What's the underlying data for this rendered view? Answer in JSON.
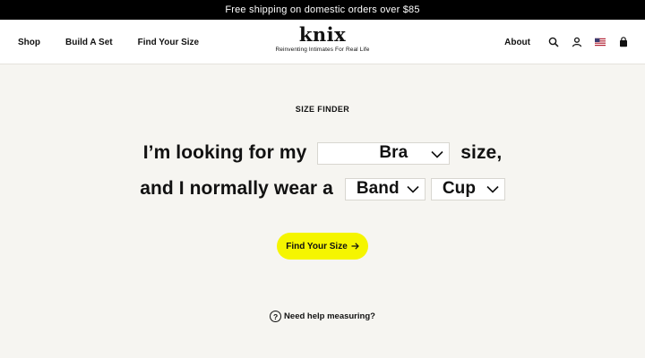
{
  "promo": {
    "text": "Free shipping on domestic orders over $85"
  },
  "nav": {
    "shop": "Shop",
    "build": "Build A Set",
    "find": "Find Your Size",
    "about": "About"
  },
  "logo": {
    "word": "knix",
    "tagline": "Reinventing Intimates For Real Life"
  },
  "icons": {
    "search": "search-icon",
    "account": "account-icon",
    "flag": "us-flag-icon",
    "cart": "shopping-bag-icon"
  },
  "finder": {
    "eyebrow": "SIZE FINDER",
    "line1_prefix": "I’m looking for my ",
    "line1_suffix": " size,",
    "type_value": "Bra",
    "line2_prefix": "and I normally wear a ",
    "band_value": "Band",
    "cup_value": "Cup",
    "cta_label": "Find Your Size",
    "help_symbol": "?",
    "help_label": "Need help measuring?"
  },
  "colors": {
    "accent": "#f5f500",
    "background": "#f6f5f1",
    "promo_bg": "#000000"
  }
}
